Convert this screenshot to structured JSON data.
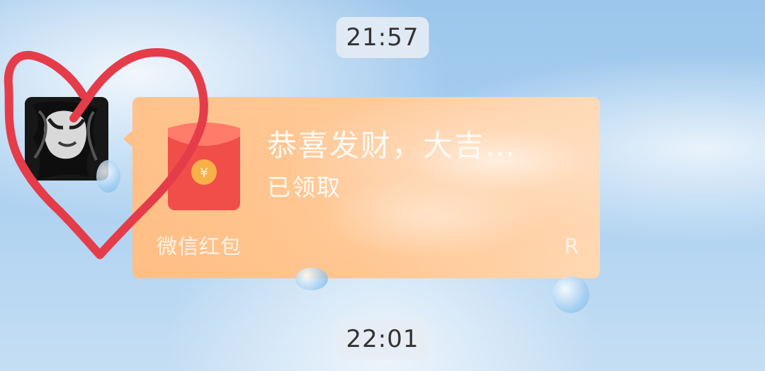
{
  "chat": {
    "timestamps": [
      "21:57",
      "22:01"
    ],
    "message": {
      "type": "red_packet",
      "title": "恭喜发财，大吉…",
      "status": "已领取",
      "brand": "微信红包",
      "code": "R",
      "icons": {
        "avatar": "profile-avatar",
        "packet": "red-envelope-icon",
        "heart": "heart-drawing-icon"
      },
      "colors": {
        "card_main": "#ffbf86",
        "card_light": "#ffd7b1",
        "packet_red": "#f24e49",
        "heart_red": "#e53c4a"
      }
    }
  }
}
